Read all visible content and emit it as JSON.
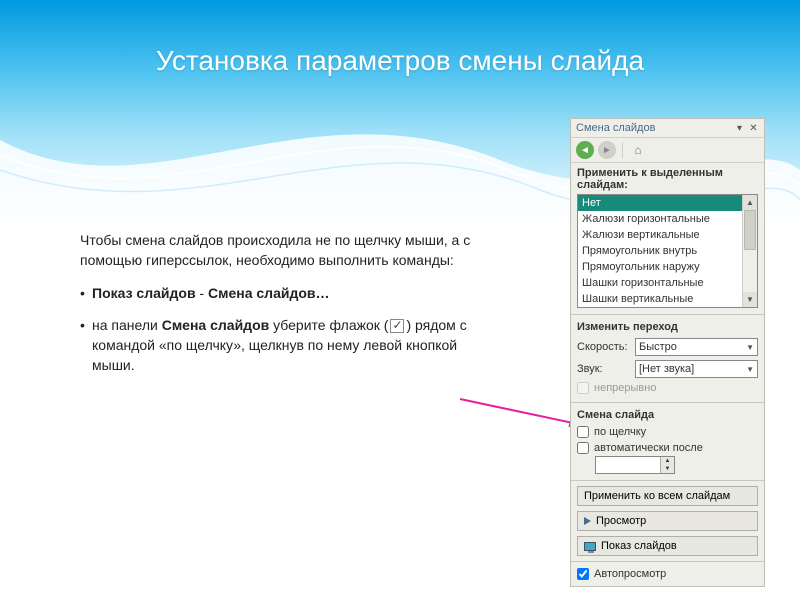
{
  "slide": {
    "title": "Установка параметров смены слайда",
    "para1": "Чтобы смена слайдов происходила не по щелчку мыши, а с помощью гиперссылок, необходимо выполнить команды:",
    "bullet1_a": "Показ слайдов",
    "bullet1_b": "Смена слайдов…",
    "bullet2_a": "на панели ",
    "bullet2_b": "Смена слайдов",
    "bullet2_c": " уберите флажок (",
    "bullet2_d": ") рядом с командой «по щелчку», щелкнув по нему левой кнопкой мыши."
  },
  "pane": {
    "title": "Смена слайдов",
    "apply_label": "Применить к выделенным слайдам:",
    "transitions": [
      "Нет",
      "Жалюзи горизонтальные",
      "Жалюзи вертикальные",
      "Прямоугольник внутрь",
      "Прямоугольник наружу",
      "Шашки горизонтальные",
      "Шашки вертикальные"
    ],
    "modify_label": "Изменить переход",
    "speed_label": "Скорость:",
    "speed_value": "Быстро",
    "sound_label": "Звук:",
    "sound_value": "[Нет звука]",
    "loop_label": "непрерывно",
    "advance_label": "Смена слайда",
    "on_click": "по щелчку",
    "auto_after": "автоматически после",
    "time_value": "",
    "apply_all": "Применить ко всем слайдам",
    "preview": "Просмотр",
    "slideshow": "Показ слайдов",
    "autopreview": "Автопросмотр"
  }
}
